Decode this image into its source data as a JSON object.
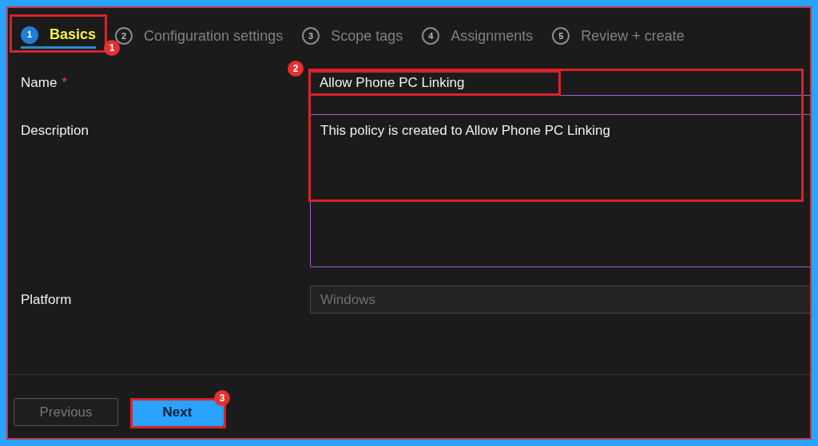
{
  "steps": [
    {
      "number": "1",
      "label": "Basics",
      "selected": true
    },
    {
      "number": "2",
      "label": "Configuration settings",
      "selected": false
    },
    {
      "number": "3",
      "label": "Scope tags",
      "selected": false
    },
    {
      "number": "4",
      "label": "Assignments",
      "selected": false
    },
    {
      "number": "5",
      "label": "Review + create",
      "selected": false
    }
  ],
  "form": [
    {
      "kind": "text",
      "label": "Name",
      "required_mark": "*",
      "value": "Allow Phone PC Linking",
      "disabled": false
    },
    {
      "kind": "textarea",
      "label": "Description",
      "value": "This policy is created to Allow Phone PC Linking",
      "disabled": false
    },
    {
      "kind": "select",
      "label": "Platform",
      "value": "Windows",
      "disabled": true
    }
  ],
  "buttons": [
    {
      "label": "Previous",
      "disabled": true
    },
    {
      "label": "Next",
      "disabled": false
    }
  ],
  "callouts": [
    "1",
    "2",
    "3"
  ]
}
